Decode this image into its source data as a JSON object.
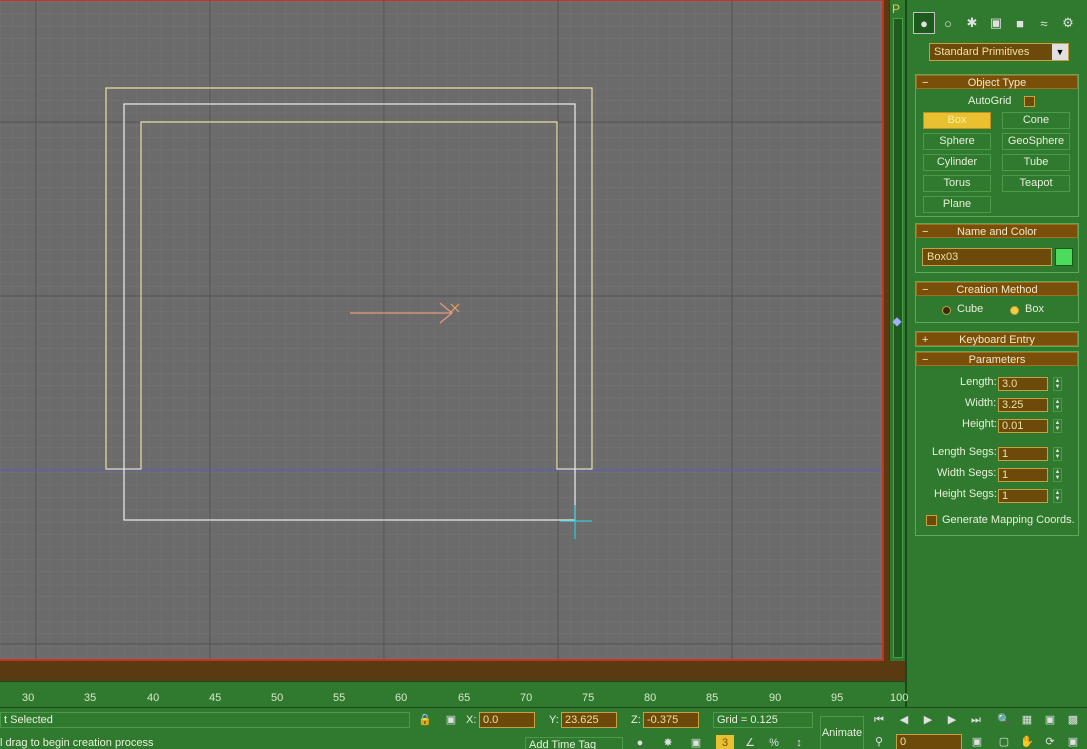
{
  "panel": {
    "dropdown_value": "Standard Primitives",
    "object_type": {
      "title": "Object Type",
      "autogrid_label": "AutoGrid",
      "buttons": [
        "Box",
        "Cone",
        "Sphere",
        "GeoSphere",
        "Cylinder",
        "Tube",
        "Torus",
        "Teapot",
        "Plane"
      ]
    },
    "name_color": {
      "title": "Name and Color",
      "name_value": "Box03",
      "color": "#4adc5a"
    },
    "creation_method": {
      "title": "Creation Method",
      "cube_label": "Cube",
      "box_label": "Box"
    },
    "keyboard_entry": {
      "title": "Keyboard Entry"
    },
    "parameters": {
      "title": "Parameters",
      "length_label": "Length:",
      "length_value": "3.0",
      "width_label": "Width:",
      "width_value": "3.25",
      "height_label": "Height:",
      "height_value": "0.01",
      "length_segs_label": "Length Segs:",
      "length_segs_value": "1",
      "width_segs_label": "Width Segs:",
      "width_segs_value": "1",
      "height_segs_label": "Height Segs:",
      "height_segs_value": "1",
      "mapping_label": "Generate Mapping Coords."
    },
    "p_label": "P"
  },
  "timeline": {
    "ticks": [
      "30",
      "35",
      "40",
      "45",
      "50",
      "55",
      "60",
      "65",
      "70",
      "75",
      "80",
      "85",
      "90",
      "95",
      "100"
    ]
  },
  "status": {
    "selected": "t Selected",
    "prompt": "l drag to begin creation process",
    "x_label": "X:",
    "x_value": "0.0",
    "y_label": "Y:",
    "y_value": "23.625",
    "z_label": "Z:",
    "z_value": "-0.375",
    "grid": "Grid = 0.125",
    "animate": "Animate",
    "add_time_tag": "Add Time Tag",
    "frame_value": "0"
  },
  "colors": {
    "panel_bg": "#2f7a2f",
    "viewport_bg": "#6b6b6b",
    "rollout_header": "#7a4f0a",
    "active_button": "#e8c030",
    "wireframe": "#e8e0a0"
  }
}
